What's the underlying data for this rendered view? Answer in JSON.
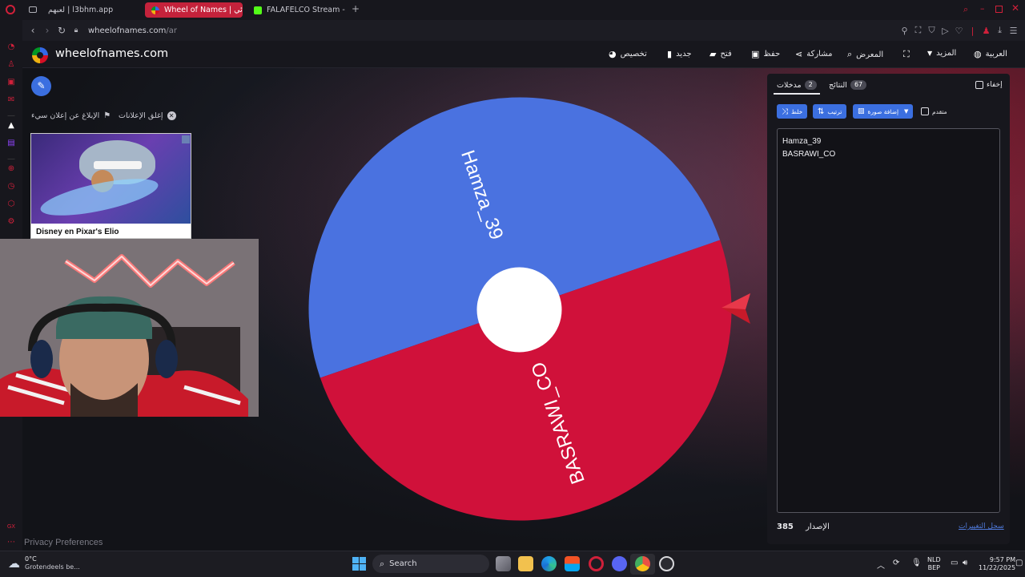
{
  "browser": {
    "tabs": [
      {
        "label": "لعبهم | l3bhm.app",
        "active": false
      },
      {
        "label": "Wheel of Names | عشوائي",
        "active": true
      },
      {
        "label": "FALAFELCO Stream - Wat",
        "active": false
      }
    ],
    "url_host": "wheelofnames.com",
    "url_path": "/ar"
  },
  "header": {
    "brand": "wheelofnames.com",
    "menu": [
      {
        "label": "تخصيص",
        "icon": "palette-icon"
      },
      {
        "label": "جديد",
        "icon": "file-icon"
      },
      {
        "label": "فتح",
        "icon": "folder-icon"
      },
      {
        "label": "حفظ",
        "icon": "save-icon"
      },
      {
        "label": "مشاركة",
        "icon": "share-icon"
      },
      {
        "label": "المعرض",
        "icon": "search-icon"
      },
      {
        "label": "",
        "icon": "fullscreen-icon"
      },
      {
        "label": "المزيد",
        "icon": "caret-down-icon"
      },
      {
        "label": "العربية",
        "icon": "globe-icon"
      }
    ]
  },
  "ads": {
    "close_ads": "إغلق الإعلانات",
    "report_ad": "الإبلاغ عن إعلان سيء",
    "ad_title": "Disney en Pixar's Elio"
  },
  "wheel": {
    "segments": [
      {
        "label": "Hamza_39",
        "color": "#4a72e0"
      },
      {
        "label": "BASRAWI_CO",
        "color": "#d0113a"
      }
    ]
  },
  "panel": {
    "hide_label": "إخفاء",
    "tab_results": "النتائج",
    "results_count": "67",
    "tab_entries": "مدخلات",
    "entries_count": "2",
    "advanced_label": "متقدم",
    "add_image_label": "إضافة صورة",
    "sort_label": "ترتيب",
    "shuffle_label": "خلط",
    "entries": [
      "Hamza_39",
      "BASRAWI_CO"
    ],
    "version_label": "الإصدار",
    "version_number": "385",
    "changelog_label": "سجل التغييرات"
  },
  "footer": {
    "privacy": "Privacy Preferences"
  },
  "taskbar": {
    "weather_temp": "0°C",
    "weather_desc": "Grotendeels be...",
    "search_label": "Search",
    "lang_top": "NLD",
    "lang_bottom": "BEP",
    "time": "9:57 PM",
    "date": "11/22/2025"
  },
  "colors": {
    "accent_blue": "#3b6fe0",
    "opera_red": "#d0203a",
    "wheel_blue": "#4a72e0",
    "wheel_red": "#d0113a"
  }
}
